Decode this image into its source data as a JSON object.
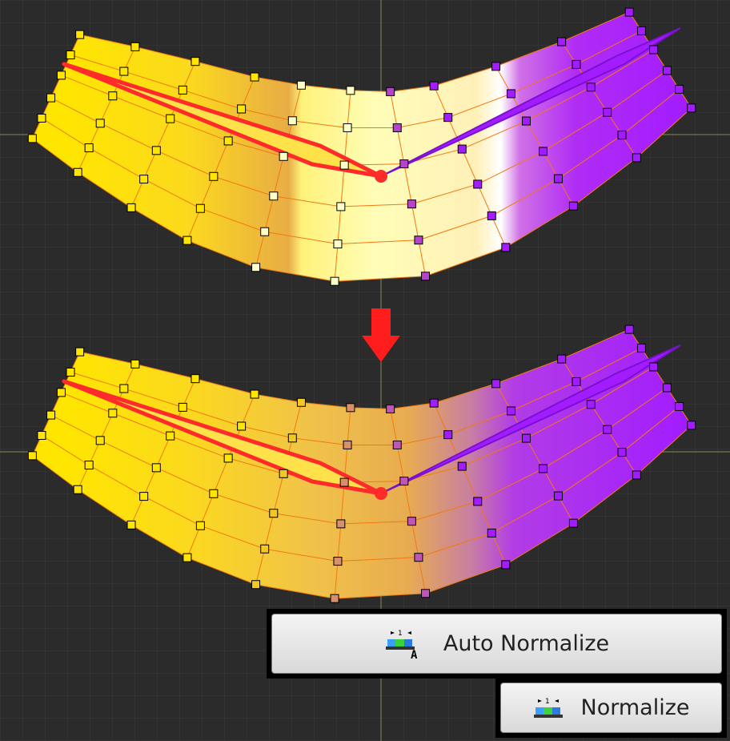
{
  "colors": {
    "background": "#2b2b2b",
    "grid": "#3a3a3a",
    "axis": "#8a8a55",
    "mesh_edge": "#f07a10",
    "bone": "#ff2a2a",
    "arrow": "#ff1c1c",
    "weight_a": "#ffe600",
    "weight_b": "#a21cff",
    "unnormalized_highlight": "#ffffc8"
  },
  "panels": [
    {
      "id": "before",
      "state": "not-normalized"
    },
    {
      "id": "after",
      "state": "normalized"
    }
  ],
  "transition_icon": "down-arrow-icon",
  "buttons": {
    "auto_normalize": {
      "label": "Auto Normalize",
      "icon": "auto-normalize-icon"
    },
    "normalize": {
      "label": "Normalize",
      "icon": "normalize-icon"
    }
  }
}
